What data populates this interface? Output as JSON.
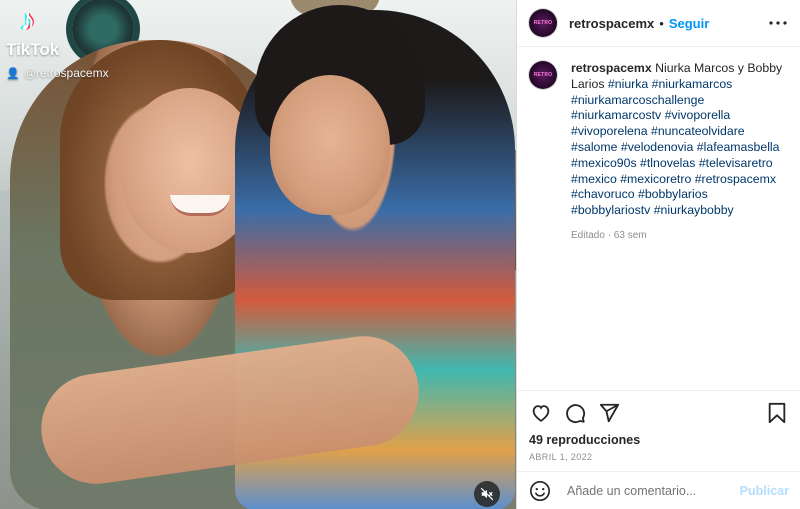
{
  "media": {
    "watermark_name": "TikTok",
    "watermark_user": "@retrospacemx"
  },
  "header": {
    "username": "retrospacemx",
    "separator": "•",
    "follow_label": "Seguir"
  },
  "caption": {
    "username": "retrospacemx",
    "text": "Niurka Marcos y Bobby Larios",
    "hashtags": "#niurka #niurkamarcos #niurkamarcoschallenge #niurkamarcostv #vivoporella #vivoporelena #nuncateolvidare #salome #velodenovia #lafeamasbella #mexico90s #tlnovelas #televisaretro #mexico #mexicoretro #retrospacemx #chavoruco #bobbylarios #bobbylariostv #niurkaybobby",
    "edited": "Editado · 63 sem"
  },
  "stats": {
    "views": "49 reproducciones",
    "date": "ABRIL 1, 2022"
  },
  "comment": {
    "placeholder": "Añade un comentario...",
    "publish_label": "Publicar"
  },
  "icons": {
    "like": "heart-icon",
    "comment": "comment-icon",
    "share": "share-icon",
    "save": "bookmark-icon",
    "more": "more-icon",
    "emoji": "emoji-icon",
    "mute": "mute-icon"
  },
  "colors": {
    "link": "#0095f6",
    "hashtag": "#00376b",
    "publish_disabled": "#b2dffc"
  }
}
